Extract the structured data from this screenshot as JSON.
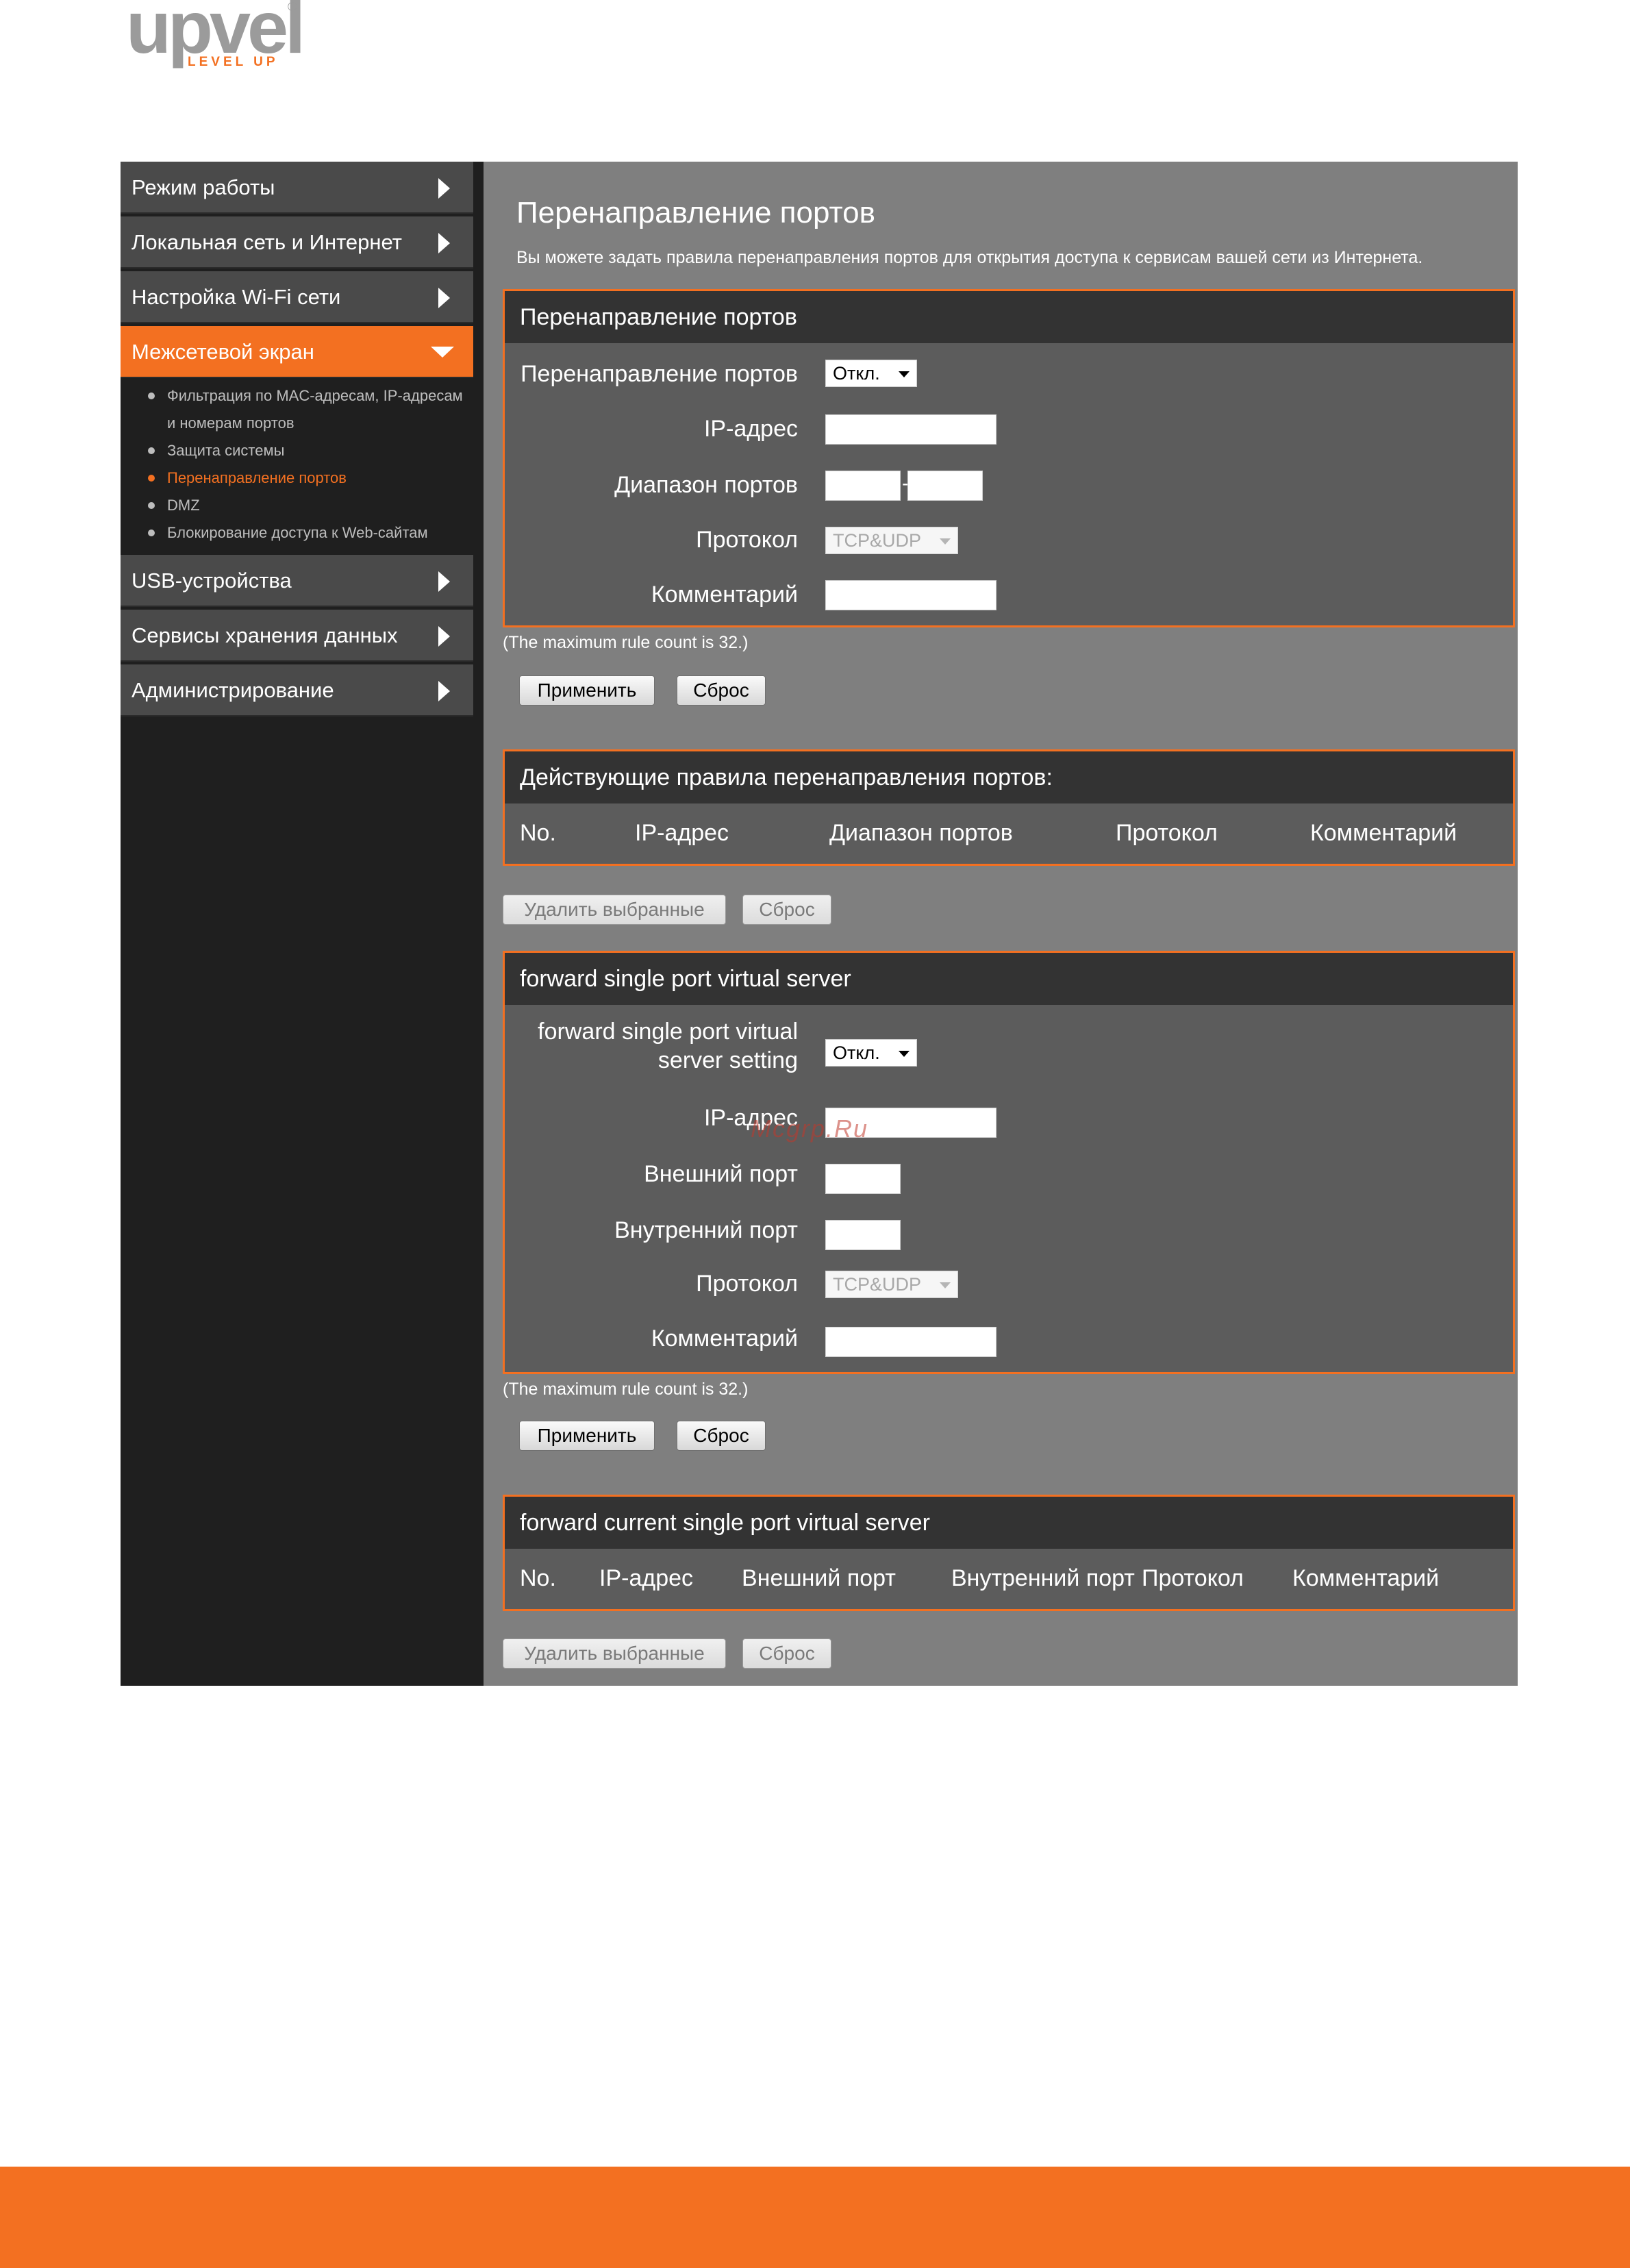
{
  "logo": {
    "main": "upvel",
    "sub": "LEVEL UP",
    "reg": "®"
  },
  "sidebar": {
    "items": [
      {
        "label": "Режим работы"
      },
      {
        "label": "Локальная сеть и Интернет"
      },
      {
        "label": "Настройка Wi-Fi сети"
      },
      {
        "label": "Межсетевой экран"
      },
      {
        "label": "USB-устройства"
      },
      {
        "label": "Сервисы хранения данных"
      },
      {
        "label": "Администрирование"
      }
    ],
    "subitems": [
      {
        "label": "Фильтрация по MAC-адресам, IP-адресам"
      },
      {
        "label": "и номерам портов"
      },
      {
        "label": "Защита системы"
      },
      {
        "label": "Перенаправление портов"
      },
      {
        "label": "DMZ"
      },
      {
        "label": "Блокирование доступа к Web-сайтам"
      }
    ]
  },
  "page": {
    "title": "Перенаправление портов",
    "description": "Вы можете задать правила перенаправления портов для открытия доступа к сервисам вашей сети из Интернета."
  },
  "panel1": {
    "header": "Перенаправление портов",
    "labels": {
      "forwarding": "Перенаправление портов",
      "ip": "IP-адрес",
      "port_range": "Диапазон портов",
      "protocol": "Протокол",
      "comment": "Комментарий"
    },
    "forwarding_value": "Откл.",
    "protocol_value": "TCP&UDP",
    "range_separator": "-"
  },
  "note1": "(The maximum rule count is 32.)",
  "buttons": {
    "apply": "Применить",
    "reset": "Сброс",
    "delete_selected": "Удалить выбранные"
  },
  "panel2": {
    "header": "Действующие правила перенаправления портов:",
    "columns": [
      "No.",
      "IP-адрес",
      "Диапазон портов",
      "Протокол",
      "Комментарий"
    ]
  },
  "panel3": {
    "header": "forward single port virtual server",
    "labels": {
      "setting": "forward single port virtual server setting",
      "ip": "IP-адрес",
      "external_port": "Внешний порт",
      "internal_port": "Внутренний порт",
      "protocol": "Протокол",
      "comment": "Комментарий"
    },
    "setting_value": "Откл.",
    "protocol_value": "TCP&UDP"
  },
  "note2": "(The maximum rule count is 32.)",
  "panel4": {
    "header": "forward current single port virtual server",
    "columns": [
      "No.",
      "IP-адрес",
      "Внешний порт",
      "Внутренний порт",
      "Протокол",
      "Комментарий"
    ]
  },
  "watermark": "Mcgrp.Ru",
  "colors": {
    "accent": "#f37021",
    "content_bg": "#7f7f7f",
    "sidebar_bg": "#1f1f1f",
    "panel_bg": "#5c5c5c",
    "panel_header_bg": "#333333"
  }
}
